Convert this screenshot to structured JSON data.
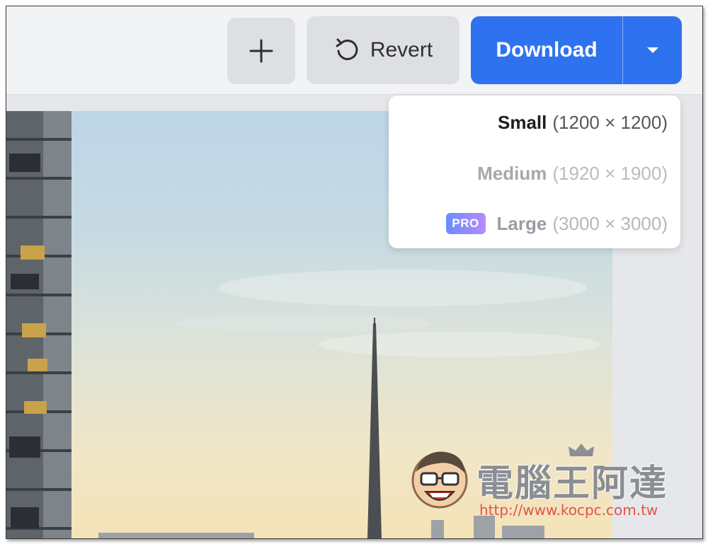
{
  "toolbar": {
    "add_button": "+",
    "revert_label": "Revert",
    "download_label": "Download"
  },
  "download_menu": {
    "options": [
      {
        "name": "Small",
        "dims": "(1200 × 1200)"
      },
      {
        "name": "Medium",
        "dims": "(1920 × 1900)"
      },
      {
        "name": "Large",
        "dims": "(3000 × 3000)",
        "badge": "PRO"
      }
    ]
  },
  "icons": {
    "add": "plus-icon",
    "revert": "undo-icon",
    "dropdown": "caret-down-icon"
  },
  "colors": {
    "accent": "#2f72f0",
    "pro_badge_start": "#6c8cff",
    "pro_badge_end": "#b48bff"
  },
  "watermark": {
    "title": "電腦王阿達",
    "url": "http://www.kocpc.com.tw"
  }
}
